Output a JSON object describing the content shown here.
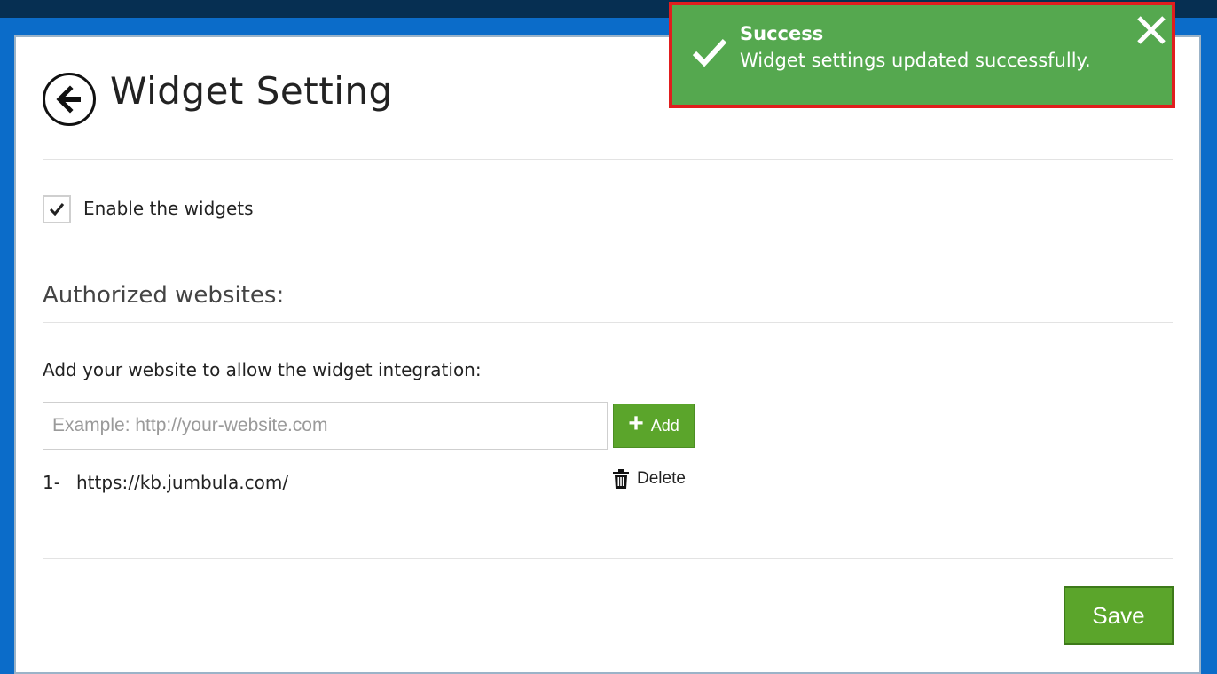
{
  "page": {
    "title": "Widget Setting",
    "enable_label": "Enable the widgets",
    "enable_checked": true,
    "section_title": "Authorized websites:",
    "instruction": "Add your website to allow the widget integration:"
  },
  "website_input": {
    "placeholder": "Example: http://your-website.com",
    "value": ""
  },
  "add_button": {
    "label": "Add",
    "icon": "plus-icon"
  },
  "websites": [
    {
      "index": "1-",
      "url": "https://kb.jumbula.com/",
      "delete_label": "Delete",
      "delete_icon": "trash-icon"
    }
  ],
  "save_button": {
    "label": "Save"
  },
  "toast": {
    "title": "Success",
    "message": "Widget settings updated successfully.",
    "icon": "checkmark-icon",
    "close_icon": "close-icon"
  },
  "colors": {
    "background_blue": "#0b6cc9",
    "topbar": "#062f52",
    "primary_green": "#5ba52b",
    "toast_green": "#55a84f",
    "toast_border": "#e01e1e"
  }
}
